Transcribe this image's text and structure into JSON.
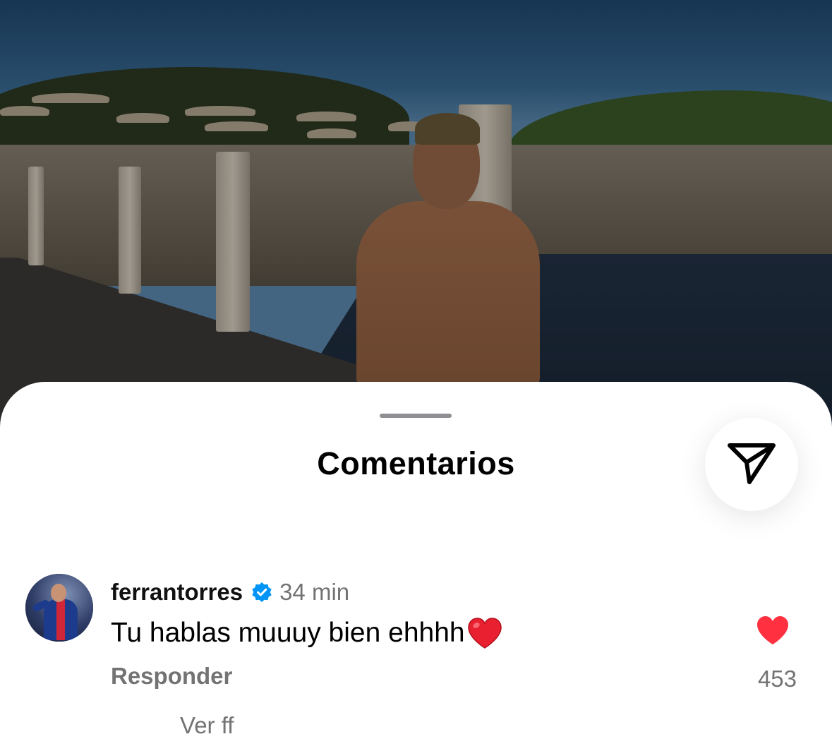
{
  "sheet": {
    "title": "Comentarios",
    "share_icon": "paper-plane-icon"
  },
  "comment": {
    "avatar_icon": "avatar",
    "username": "ferrantorres",
    "verified_icon": "verified-badge-icon",
    "timestamp": "34 min",
    "text": "Tu hablas muuuy bien ehhhh",
    "emoji": "❤️",
    "reply_label": "Responder",
    "like_icon": "heart-filled-icon",
    "like_count": "453",
    "view_replies_partial": "Ver ff"
  },
  "colors": {
    "like_red": "#ff3040",
    "verified_blue": "#0095f6",
    "secondary_text": "#737373"
  }
}
